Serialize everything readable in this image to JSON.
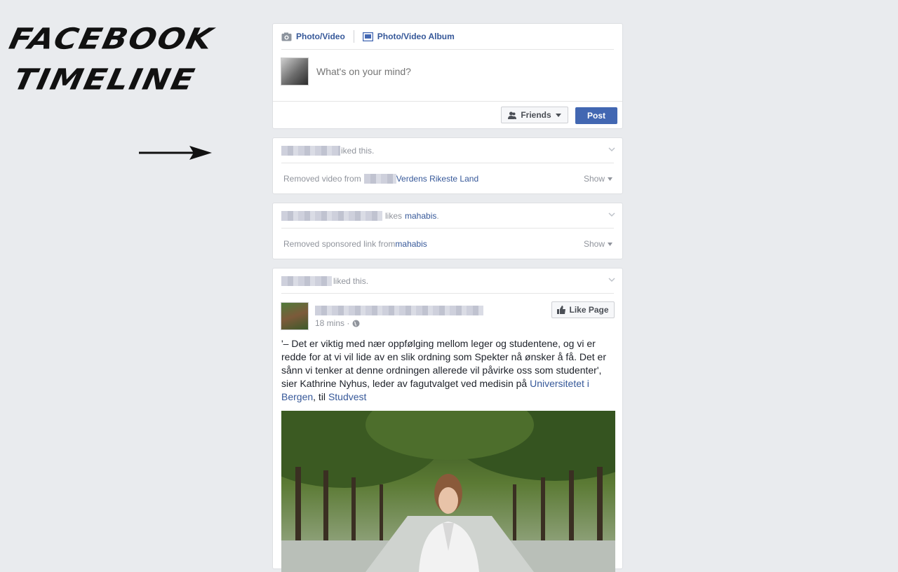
{
  "title": {
    "line1": "FACEBOOK",
    "line2": "TIMELINE"
  },
  "composer": {
    "tab_photo": "Photo/Video",
    "tab_album": "Photo/Video Album",
    "placeholder": "What's on your mind?",
    "audience": "Friends",
    "post": "Post"
  },
  "stories": [
    {
      "action": "iked this.",
      "removed_prefix": "Removed video from ",
      "removed_link": "Verdens Rikeste Land",
      "show": "Show"
    },
    {
      "action_prefix": "likes ",
      "action_link": "mahabis",
      "action_suffix": ".",
      "removed_prefix": "Removed sponsored link from ",
      "removed_link": "mahabis",
      "show": "Show"
    },
    {
      "action": "liked this.",
      "time": "18 mins · ",
      "like_page": "Like Page",
      "text_pre": "'– Det er viktig med nær oppfølging mellom leger og studentene, og vi er redde for at vi vil lide av en slik ordning som Spekter nå ønsker å få. Det er sånn vi tenker at denne ordningen allerede vil påvirke oss som studenter', sier Kathrine Nyhus, leder av fagutvalget ved medisin på ",
      "text_link1": "Universitetet i Bergen",
      "text_mid": ", til ",
      "text_link2": "Studvest"
    }
  ],
  "icons": {
    "camera": "camera-icon",
    "album": "album-icon",
    "friends": "friends-icon",
    "chevron": "chevron-down-icon",
    "globe": "globe-icon",
    "thumb": "thumbs-up-icon",
    "arrow": "arrow-right-icon"
  },
  "colors": {
    "link": "#365899",
    "primary": "#4267b2",
    "muted": "#90949c",
    "background": "#e9ebee"
  }
}
